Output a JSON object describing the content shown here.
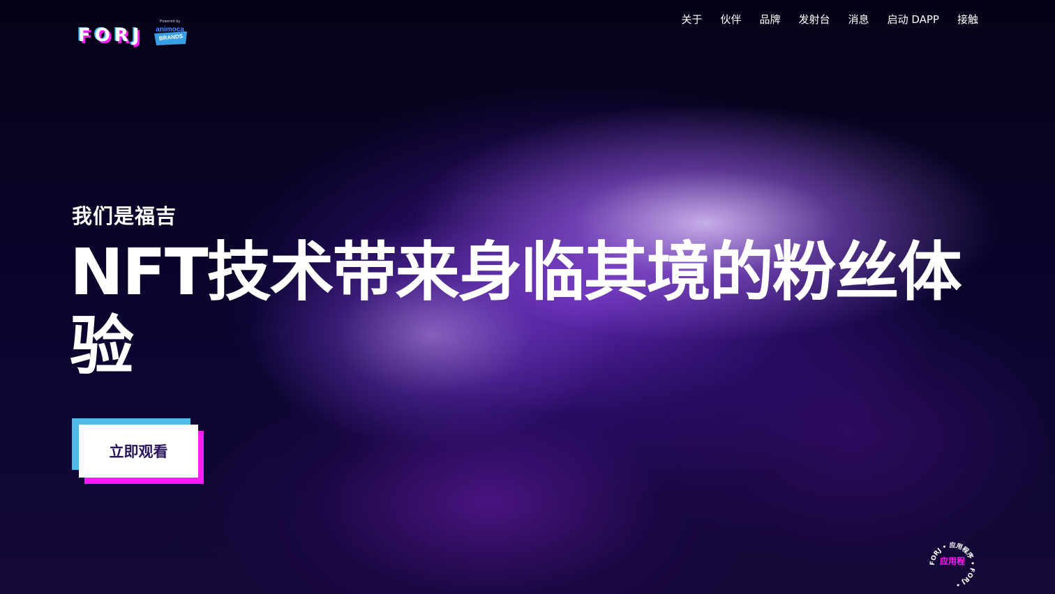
{
  "header": {
    "logo_letters": [
      "F",
      "O",
      "R",
      "J"
    ],
    "powered_label": "Powered by",
    "partner_line1": "animoca",
    "partner_line2": "BRANDS",
    "nav": [
      {
        "label": "关于"
      },
      {
        "label": "伙伴"
      },
      {
        "label": "品牌"
      },
      {
        "label": "发射台"
      },
      {
        "label": "消息"
      },
      {
        "label": "启动 DAPP"
      },
      {
        "label": "接触"
      }
    ]
  },
  "hero": {
    "kicker": "我们是福吉",
    "title": "NFT技术带来身临其境的粉丝体验",
    "cta_label": "立即观看"
  },
  "badge": {
    "label": "应用程",
    "ring_text": "FORJ • 应用程序 • FORJ •"
  },
  "colors": {
    "accent_pink": "#ff1cf7",
    "accent_blue": "#4fb9e8",
    "cta_text": "#2a145c"
  }
}
